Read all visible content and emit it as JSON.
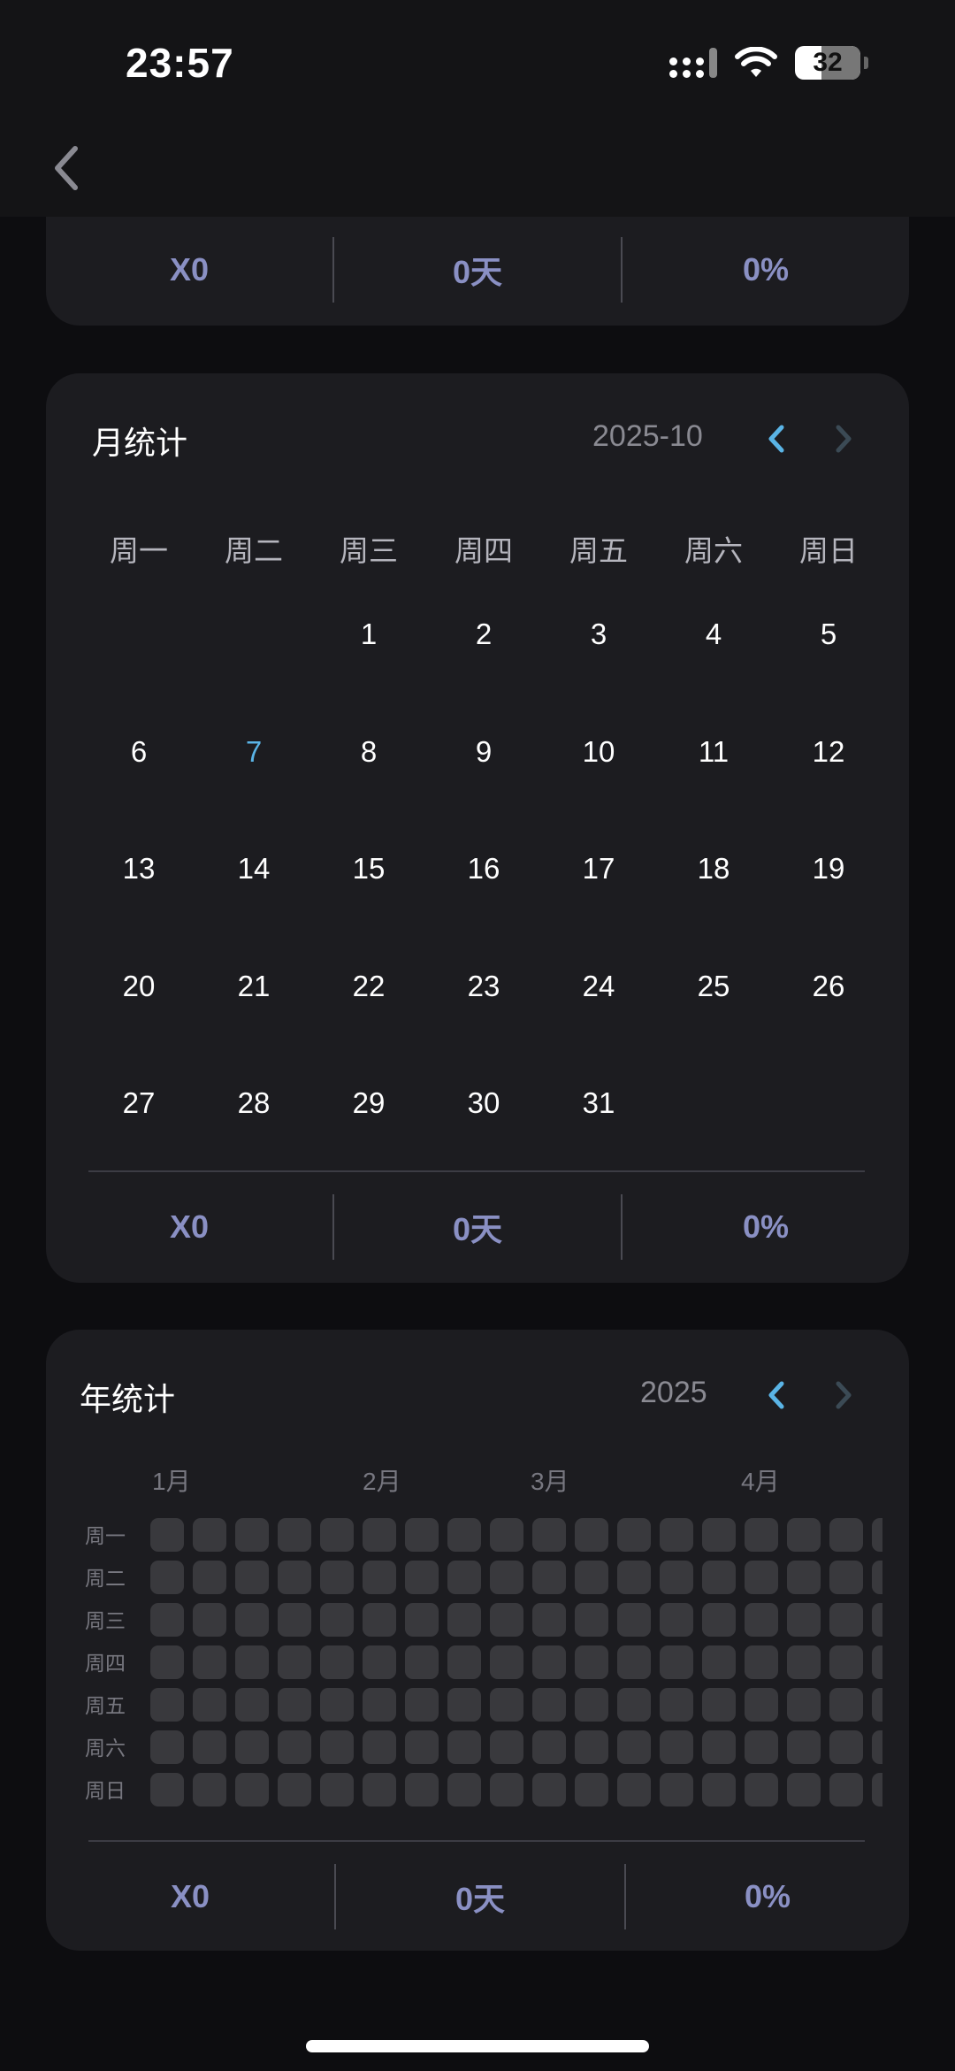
{
  "status_bar": {
    "time": "23:57",
    "battery": "32"
  },
  "top_card": {
    "stats": [
      "X0",
      "0天",
      "0%"
    ]
  },
  "month_card": {
    "title": "月统计",
    "period": "2025-10",
    "weekdays": [
      "周一",
      "周二",
      "周三",
      "周四",
      "周五",
      "周六",
      "周日"
    ],
    "weeks": [
      [
        "",
        "",
        "1",
        "2",
        "3",
        "4",
        "5"
      ],
      [
        "6",
        "7",
        "8",
        "9",
        "10",
        "11",
        "12"
      ],
      [
        "13",
        "14",
        "15",
        "16",
        "17",
        "18",
        "19"
      ],
      [
        "20",
        "21",
        "22",
        "23",
        "24",
        "25",
        "26"
      ],
      [
        "27",
        "28",
        "29",
        "30",
        "31",
        "",
        ""
      ]
    ],
    "today": "7",
    "stats": [
      "X0",
      "0天",
      "0%"
    ]
  },
  "year_card": {
    "title": "年统计",
    "period": "2025",
    "months": [
      "1月",
      "2月",
      "3月",
      "4月"
    ],
    "row_labels": [
      "周一",
      "周二",
      "周三",
      "周四",
      "周五",
      "周六",
      "周日"
    ],
    "stats": [
      "X0",
      "0天",
      "0%"
    ]
  },
  "colors": {
    "accent": "#5ab4e6",
    "stat": "#8a90c4",
    "card": "#1c1c20",
    "cell": "#39393d"
  },
  "icons": {
    "back": "chevron-left-icon",
    "prev": "chevron-left-icon",
    "next": "chevron-right-icon"
  }
}
